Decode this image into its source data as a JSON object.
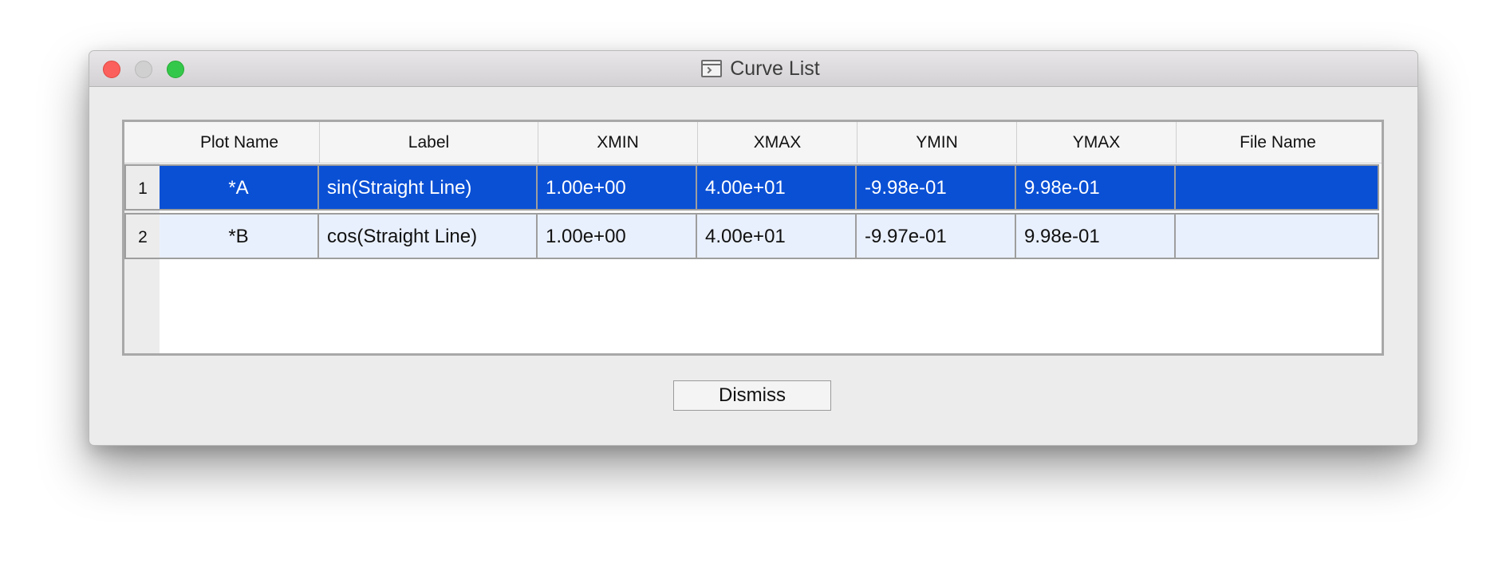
{
  "window": {
    "title": "Curve List",
    "title_icon": "terminal-window-icon"
  },
  "table": {
    "columns": [
      "Plot Name",
      "Label",
      "XMIN",
      "XMAX",
      "YMIN",
      "YMAX",
      "File Name"
    ],
    "rows": [
      {
        "num": "1",
        "selected": true,
        "cells": [
          "*A",
          "sin(Straight Line)",
          "1.00e+00",
          "4.00e+01",
          "-9.98e-01",
          "9.98e-01",
          ""
        ]
      },
      {
        "num": "2",
        "selected": false,
        "cells": [
          "*B",
          "cos(Straight Line)",
          "1.00e+00",
          "4.00e+01",
          "-9.97e-01",
          "9.98e-01",
          ""
        ]
      }
    ]
  },
  "buttons": {
    "dismiss": "Dismiss"
  },
  "colors": {
    "selected_row": "#0a50d5",
    "alternate_row": "#e9f0fd",
    "close": "#fc605c",
    "zoom": "#34c84a"
  }
}
